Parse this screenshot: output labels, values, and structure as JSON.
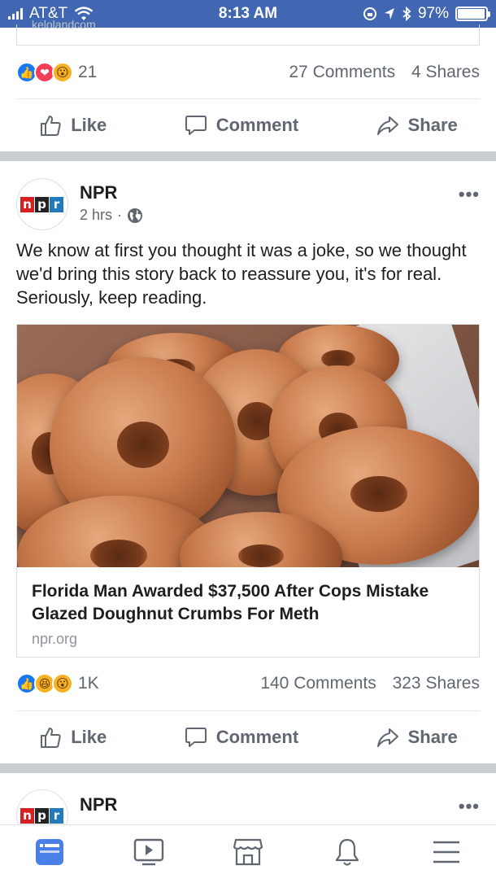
{
  "status_bar": {
    "carrier": "AT&T",
    "time": "8:13 AM",
    "battery": "97%",
    "battery_level": 0.97
  },
  "prev_post": {
    "link_domain_fragment": "kelolandcom",
    "reaction_count": "21",
    "comments": "27 Comments",
    "shares": "4 Shares"
  },
  "actions": {
    "like": "Like",
    "comment": "Comment",
    "share": "Share"
  },
  "post": {
    "page_name": "NPR",
    "time": "2 hrs",
    "separator": "·",
    "text": "We know at first you thought it was a joke, so we thought we'd bring this story back to reassure you, it's for real. Seriously, keep reading.",
    "link": {
      "title": "Florida Man Awarded $37,500 After Cops Mistake Glazed Doughnut Crumbs For Meth",
      "domain": "npr.org"
    },
    "reaction_count": "1K",
    "comments": "140 Comments",
    "shares": "323 Shares"
  },
  "next_post": {
    "page_name": "NPR"
  },
  "logo": {
    "n": "n",
    "p": "p",
    "r": "r"
  },
  "more_label": "•••",
  "colors": {
    "brand": "#4267b2",
    "like": "#1877f2",
    "love": "#f33e58",
    "wow": "#f7b125"
  },
  "tabs": [
    "news-feed-icon",
    "watch-icon",
    "marketplace-icon",
    "notifications-icon",
    "menu-icon"
  ]
}
